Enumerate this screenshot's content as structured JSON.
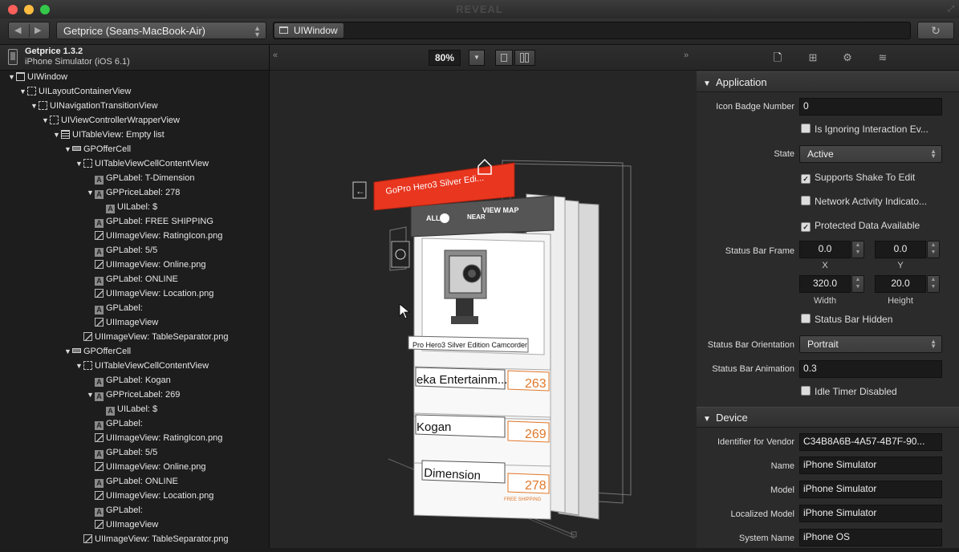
{
  "window": {
    "title": "REVEAL"
  },
  "toolbar": {
    "app_selector": "Getprice (Seans-MacBook-Air)",
    "breadcrumb": "UIWindow"
  },
  "left_panel": {
    "app_name": "Getprice 1.3.2",
    "device": "iPhone Simulator (iOS 6.1)",
    "tree": [
      {
        "label": "UIWindow",
        "depth": 0,
        "icon": "window-icon",
        "expanded": true
      },
      {
        "label": "UILayoutContainerView",
        "depth": 1,
        "icon": "view-icon",
        "expanded": true
      },
      {
        "label": "UINavigationTransitionView",
        "depth": 2,
        "icon": "view-icon",
        "expanded": true
      },
      {
        "label": "UIViewControllerWrapperView",
        "depth": 3,
        "icon": "view-icon",
        "expanded": true
      },
      {
        "label": "UITableView: Empty list",
        "depth": 4,
        "icon": "table-icon",
        "expanded": true
      },
      {
        "label": "GPOfferCell",
        "depth": 5,
        "icon": "cell-icon",
        "expanded": true
      },
      {
        "label": "UITableViewCellContentView",
        "depth": 6,
        "icon": "view-icon",
        "expanded": true
      },
      {
        "label": "GPLabel: T-Dimension",
        "depth": 7,
        "icon": "label-icon"
      },
      {
        "label": "GPPriceLabel: 278",
        "depth": 7,
        "icon": "label-icon",
        "expanded": true
      },
      {
        "label": "UILabel: $",
        "depth": 8,
        "icon": "label-icon"
      },
      {
        "label": "GPLabel: FREE SHIPPING",
        "depth": 7,
        "icon": "label-icon"
      },
      {
        "label": "UIImageView: RatingIcon.png",
        "depth": 7,
        "icon": "image-icon"
      },
      {
        "label": "GPLabel: 5/5",
        "depth": 7,
        "icon": "label-icon"
      },
      {
        "label": "UIImageView: Online.png",
        "depth": 7,
        "icon": "image-icon"
      },
      {
        "label": "GPLabel: ONLINE",
        "depth": 7,
        "icon": "label-icon"
      },
      {
        "label": "UIImageView: Location.png",
        "depth": 7,
        "icon": "image-icon"
      },
      {
        "label": "GPLabel:",
        "depth": 7,
        "icon": "label-icon"
      },
      {
        "label": "UIImageView",
        "depth": 7,
        "icon": "image-icon"
      },
      {
        "label": "UIImageView: TableSeparator.png",
        "depth": 6,
        "icon": "image-icon"
      },
      {
        "label": "GPOfferCell",
        "depth": 5,
        "icon": "cell-icon",
        "expanded": true
      },
      {
        "label": "UITableViewCellContentView",
        "depth": 6,
        "icon": "view-icon",
        "expanded": true
      },
      {
        "label": "GPLabel: Kogan",
        "depth": 7,
        "icon": "label-icon"
      },
      {
        "label": "GPPriceLabel: 269",
        "depth": 7,
        "icon": "label-icon",
        "expanded": true
      },
      {
        "label": "UILabel: $",
        "depth": 8,
        "icon": "label-icon"
      },
      {
        "label": "GPLabel:",
        "depth": 7,
        "icon": "label-icon"
      },
      {
        "label": "UIImageView: RatingIcon.png",
        "depth": 7,
        "icon": "image-icon"
      },
      {
        "label": "GPLabel: 5/5",
        "depth": 7,
        "icon": "label-icon"
      },
      {
        "label": "UIImageView: Online.png",
        "depth": 7,
        "icon": "image-icon"
      },
      {
        "label": "GPLabel: ONLINE",
        "depth": 7,
        "icon": "label-icon"
      },
      {
        "label": "UIImageView: Location.png",
        "depth": 7,
        "icon": "image-icon"
      },
      {
        "label": "GPLabel:",
        "depth": 7,
        "icon": "label-icon"
      },
      {
        "label": "UIImageView",
        "depth": 7,
        "icon": "image-icon"
      },
      {
        "label": "UIImageView: TableSeparator.png",
        "depth": 6,
        "icon": "image-icon"
      }
    ]
  },
  "center": {
    "zoom": "80%",
    "preview": {
      "nav_title": "GoPro Hero3 Silver Edi...",
      "filter_all": "ALL",
      "filter_near": "NEAR",
      "view_map": "VIEW MAP",
      "product_name": "Pro Hero3 Silver Edition Camcorder",
      "offers": [
        {
          "name": "eka Entertainm...",
          "price": "263"
        },
        {
          "name": "Kogan",
          "price": "269"
        },
        {
          "name": "Dimension",
          "price": "278"
        }
      ],
      "free_shipping": "FREE SHIPPING"
    }
  },
  "inspector": {
    "section_application": "Application",
    "icon_badge_label": "Icon Badge Number",
    "icon_badge_value": "0",
    "ignoring_interaction": "Is Ignoring Interaction Ev...",
    "state_label": "State",
    "state_value": "Active",
    "supports_shake": "Supports Shake To Edit",
    "network_activity": "Network Activity Indicato...",
    "protected_data": "Protected Data Available",
    "status_bar_frame_label": "Status Bar Frame",
    "frame": {
      "x": "0.0",
      "y": "0.0",
      "width": "320.0",
      "height": "20.0"
    },
    "frame_labels": {
      "x": "X",
      "y": "Y",
      "width": "Width",
      "height": "Height"
    },
    "status_bar_hidden": "Status Bar Hidden",
    "orientation_label": "Status Bar Orientation",
    "orientation_value": "Portrait",
    "animation_label": "Status Bar Animation",
    "animation_value": "0.3",
    "idle_timer": "Idle Timer Disabled",
    "checks": {
      "ignoring_interaction": false,
      "supports_shake": true,
      "network_activity": false,
      "protected_data": true,
      "status_bar_hidden": false,
      "idle_timer": false
    },
    "section_device": "Device",
    "vendor_label": "Identifier for Vendor",
    "vendor_value": "C34B8A6B-4A57-4B7F-90...",
    "name_label": "Name",
    "name_value": "iPhone Simulator",
    "model_label": "Model",
    "model_value": "iPhone Simulator",
    "localized_label": "Localized Model",
    "localized_value": "iPhone Simulator",
    "sysname_label": "System Name",
    "sysname_value": "iPhone OS"
  },
  "colors": {
    "accent_red": "#e8361f",
    "price_orange": "#e0782a",
    "traffic_close": "#fc605b",
    "traffic_min": "#fdbc40",
    "traffic_max": "#34c84a"
  }
}
